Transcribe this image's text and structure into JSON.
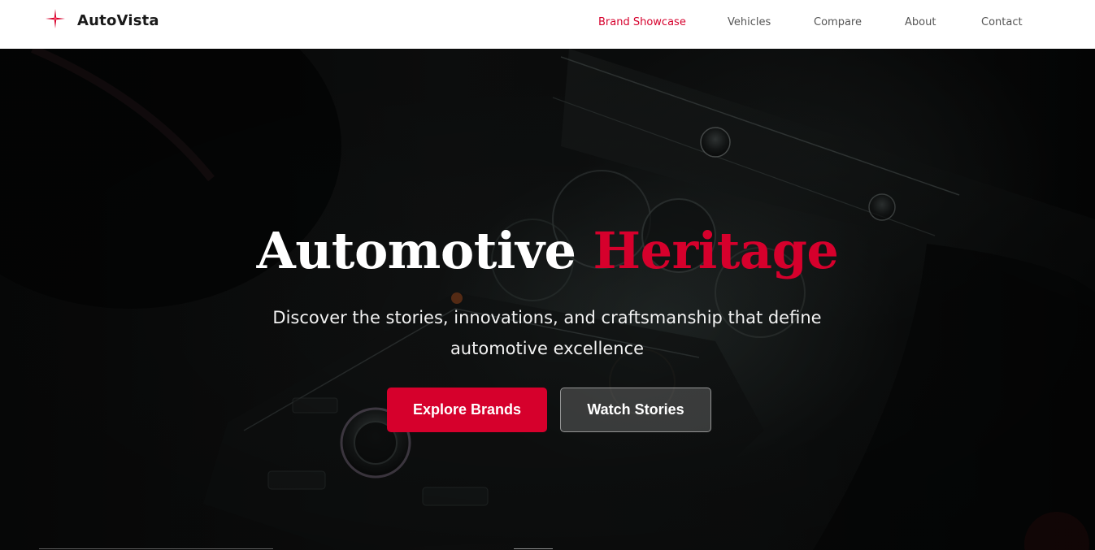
{
  "brand": {
    "name": "AutoVista",
    "logo_icon": "sparkle-icon",
    "accent_color": "#d6002c"
  },
  "nav": {
    "items": [
      {
        "label": "Brand Showcase",
        "active": true
      },
      {
        "label": "Vehicles",
        "active": false
      },
      {
        "label": "Compare",
        "active": false
      },
      {
        "label": "About",
        "active": false
      },
      {
        "label": "Contact",
        "active": false
      }
    ]
  },
  "hero": {
    "title_main": "Automotive",
    "title_accent": "Heritage",
    "subtitle": "Discover the stories, innovations, and craftsmanship that define automotive excellence",
    "primary_button": "Explore Brands",
    "secondary_button": "Watch Stories",
    "background_image": "car-dashboard-interior"
  },
  "colors": {
    "header_bg": "#ffffff",
    "nav_text": "#555555",
    "primary_button_bg": "#d6002c",
    "hero_text": "#ffffff"
  }
}
